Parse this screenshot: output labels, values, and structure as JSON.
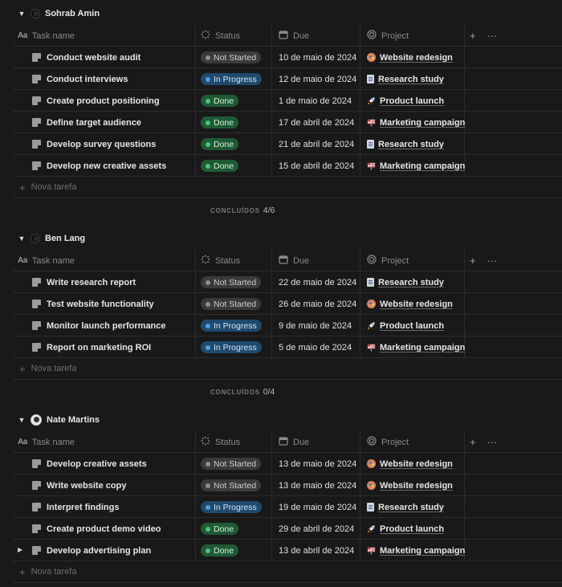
{
  "columns": {
    "name_icon": "Aa",
    "name": "Task name",
    "status": "Status",
    "due": "Due",
    "project": "Project",
    "add": "+",
    "more": "···"
  },
  "new_task_label": "Nova tarefa",
  "summary_label": "CONCLUÍDOS",
  "groups": [
    {
      "owner": "Sohrab Amin",
      "avatar": "dark",
      "summary": "4/6",
      "tasks": [
        {
          "title": "Conduct website audit",
          "status": "Not Started",
          "due": "10 de maio de 2024",
          "project": "Website redesign",
          "project_icon": "palette"
        },
        {
          "title": "Conduct interviews",
          "status": "In Progress",
          "due": "12 de maio de 2024",
          "project": "Research study",
          "project_icon": "page"
        },
        {
          "title": "Create product positioning",
          "status": "Done",
          "due": "1 de maio de 2024",
          "project": "Product launch",
          "project_icon": "rocket"
        },
        {
          "title": "Define target audience",
          "status": "Done",
          "due": "17 de abril de 2024",
          "project": "Marketing campaign",
          "project_icon": "flag"
        },
        {
          "title": "Develop survey questions",
          "status": "Done",
          "due": "21 de abril de 2024",
          "project": "Research study",
          "project_icon": "page"
        },
        {
          "title": "Develop new creative assets",
          "status": "Done",
          "due": "15 de abril de 2024",
          "project": "Marketing campaign",
          "project_icon": "flag"
        }
      ]
    },
    {
      "owner": "Ben Lang",
      "avatar": "dark",
      "summary": "0/4",
      "tasks": [
        {
          "title": "Write research report",
          "status": "Not Started",
          "due": "22 de maio de 2024",
          "project": "Research study",
          "project_icon": "page"
        },
        {
          "title": "Test website functionality",
          "status": "Not Started",
          "due": "26 de maio de 2024",
          "project": "Website redesign",
          "project_icon": "palette"
        },
        {
          "title": "Monitor launch performance",
          "status": "In Progress",
          "due": "9 de maio de 2024",
          "project": "Product launch",
          "project_icon": "rocket"
        },
        {
          "title": "Report on marketing ROI",
          "status": "In Progress",
          "due": "5 de maio de 2024",
          "project": "Marketing campaign",
          "project_icon": "flag"
        }
      ]
    },
    {
      "owner": "Nate Martins",
      "avatar": "light",
      "summary": "",
      "tasks": [
        {
          "title": "Develop creative assets",
          "status": "Not Started",
          "due": "13 de maio de 2024",
          "project": "Website redesign",
          "project_icon": "palette"
        },
        {
          "title": "Write website copy",
          "status": "Not Started",
          "due": "13 de maio de 2024",
          "project": "Website redesign",
          "project_icon": "palette"
        },
        {
          "title": "Interpret findings",
          "status": "In Progress",
          "due": "19 de maio de 2024",
          "project": "Research study",
          "project_icon": "page"
        },
        {
          "title": "Create product demo video",
          "status": "Done",
          "due": "29 de abril de 2024",
          "project": "Product launch",
          "project_icon": "rocket"
        },
        {
          "title": "Develop advertising plan",
          "status": "Done",
          "due": "13 de abril de 2024",
          "project": "Marketing campaign",
          "project_icon": "flag",
          "expandable": true
        }
      ]
    }
  ],
  "status_colors": {
    "Not Started": "#3a3a3a",
    "In Progress": "#1f4a6e",
    "Done": "#1f5a35"
  }
}
